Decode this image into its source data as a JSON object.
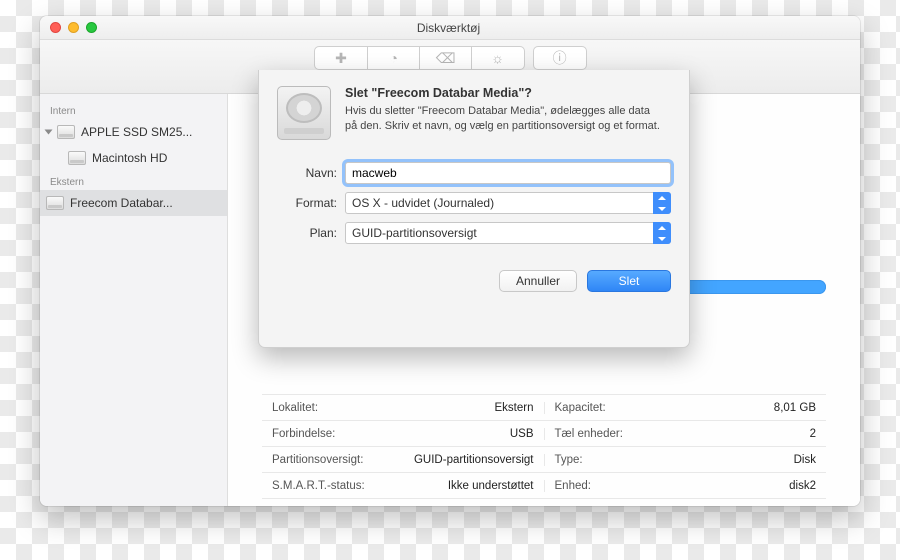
{
  "window": {
    "title": "Diskværktøj"
  },
  "toolbar": {
    "first_aid": "Førstehjælp",
    "partition": "Partitioner",
    "erase": "Slet",
    "mount": "Gør aktiv",
    "info": "Info"
  },
  "sidebar": {
    "internal_header": "Intern",
    "external_header": "Ekstern",
    "internal": [
      {
        "label": "APPLE SSD SM25..."
      },
      {
        "label": "Macintosh HD"
      }
    ],
    "external": [
      {
        "label": "Freecom Databar..."
      }
    ]
  },
  "sheet": {
    "title": "Slet \"Freecom Databar Media\"?",
    "body": "Hvis du sletter \"Freecom Databar Media\", ødelægges alle data på den. Skriv et navn, og vælg en partitionsoversigt og et format.",
    "name_label": "Navn:",
    "name_value": "macweb",
    "format_label": "Format:",
    "format_value": "OS X - udvidet (Journaled)",
    "scheme_label": "Plan:",
    "scheme_value": "GUID-partitionsoversigt",
    "cancel": "Annuller",
    "confirm": "Slet"
  },
  "info": {
    "rows": [
      {
        "k1": "Lokalitet:",
        "v1": "Ekstern",
        "k2": "Kapacitet:",
        "v2": "8,01 GB"
      },
      {
        "k1": "Forbindelse:",
        "v1": "USB",
        "k2": "Tæl enheder:",
        "v2": "2"
      },
      {
        "k1": "Partitionsoversigt:",
        "v1": "GUID-partitionsoversigt",
        "k2": "Type:",
        "v2": "Disk"
      },
      {
        "k1": "S.M.A.R.T.-status:",
        "v1": "Ikke understøttet",
        "k2": "Enhed:",
        "v2": "disk2"
      }
    ]
  }
}
